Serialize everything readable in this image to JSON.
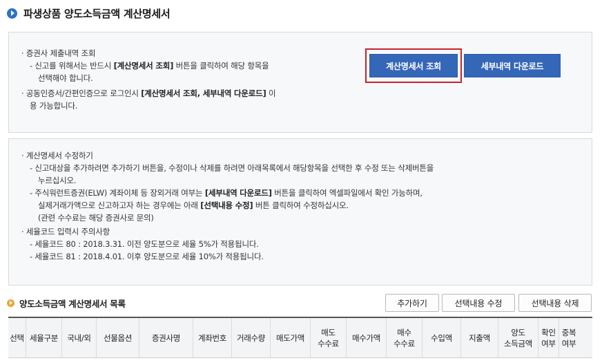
{
  "page_title": "파생상품 양도소득금액 계산명세서",
  "info1": {
    "lines": [
      "· 증권사 제출내역 조회",
      "- 신고를 위해서는 반드시 ",
      "[계산명세서 조회]",
      " 버튼을 클릭하여 해당 항목을",
      "선택해야 합니다.",
      "· 공동인증서/간편인증으로 로그인시 ",
      "[계산명세서 조회, 세부내역 다운로드]",
      " 이",
      "용 가능합니다."
    ],
    "view_button": "계산명세서 조회",
    "download_button": "세부내역 다운로드"
  },
  "info2": {
    "lines": [
      "· 계산명세서 수정하기",
      "- 신고대상을 추가하려면 추가하기 버튼을, 수정이나 삭제를 하려면 아래목록에서 해당항목을 선택한 후 수정 또는 삭제버튼을",
      "누르십시오.",
      "- 주식워런트증권(ELW) 계좌이체 등 장외거래 여부는 ",
      "[세부내역 다운로드]",
      " 버튼을 클릭하여 엑셀파일에서 확인 가능하며,",
      "실제거래가액으로 신고하고자 하는 경우에는 아래 ",
      "[선택내용 수정]",
      " 버튼 클릭하여 수정하십시오.",
      "(관련 수수료는 해당 증권사로 문의)",
      "· 세율코드 입력시 주의사항",
      "- 세율코드 80 : 2018.3.31. 이전 양도분으로 세율 5%가 적용됩니다.",
      "- 세율코드 81 : 2018.4.01. 이후 양도분으로 세율 10%가 적용됩니다."
    ]
  },
  "list": {
    "title": "양도소득금액 계산명세서 목록",
    "add_button": "추가하기",
    "edit_button": "선택내용 수정",
    "delete_button": "선택내용 삭제",
    "columns": [
      "선택",
      "세율구분",
      "국내/외",
      "선물옵션",
      "증권사명",
      "계좌번호",
      "거래수량",
      "매도가액",
      "매도\n수수료",
      "매수가액",
      "매수\n수수료",
      "수입액",
      "지출액",
      "양도\n소득금액",
      "확인\n여부",
      "중복\n여부"
    ]
  }
}
